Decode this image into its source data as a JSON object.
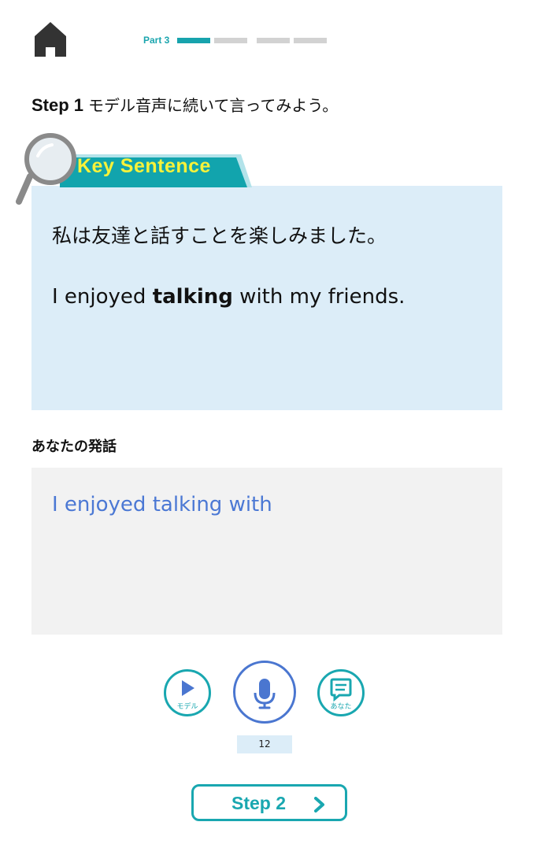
{
  "header": {
    "part_label": "Part 3",
    "progress_segments": [
      {
        "state": "active"
      },
      {
        "state": "inactive"
      },
      {
        "state": "inactive"
      },
      {
        "state": "inactive"
      }
    ]
  },
  "step": {
    "number": "Step 1",
    "instruction": "モデル音声に続いて言ってみよう。"
  },
  "key_sentence": {
    "tab_label": "Key Sentence",
    "japanese": "私は友達と話すことを楽しみました。",
    "english_before": "I enjoyed ",
    "english_bold": "talking",
    "english_after": " with my friends."
  },
  "speech": {
    "label": "あなたの発話",
    "text": "I enjoyed talking with"
  },
  "controls": {
    "model_caption": "モデル",
    "you_caption": "あなた",
    "counter": "12"
  },
  "next": {
    "label": "Step 2"
  },
  "colors": {
    "teal": "#19a7b0",
    "blue": "#4a76d0",
    "key_bg": "#dcedf8",
    "speech_bg": "#f2f2f2",
    "key_text": "#f7f23a"
  },
  "icons": {
    "home": "home-icon",
    "magnifier": "magnifier-icon",
    "play": "play-icon",
    "mic": "microphone-icon",
    "you": "speech-bubble-icon",
    "next": "chevron-right-icon"
  }
}
